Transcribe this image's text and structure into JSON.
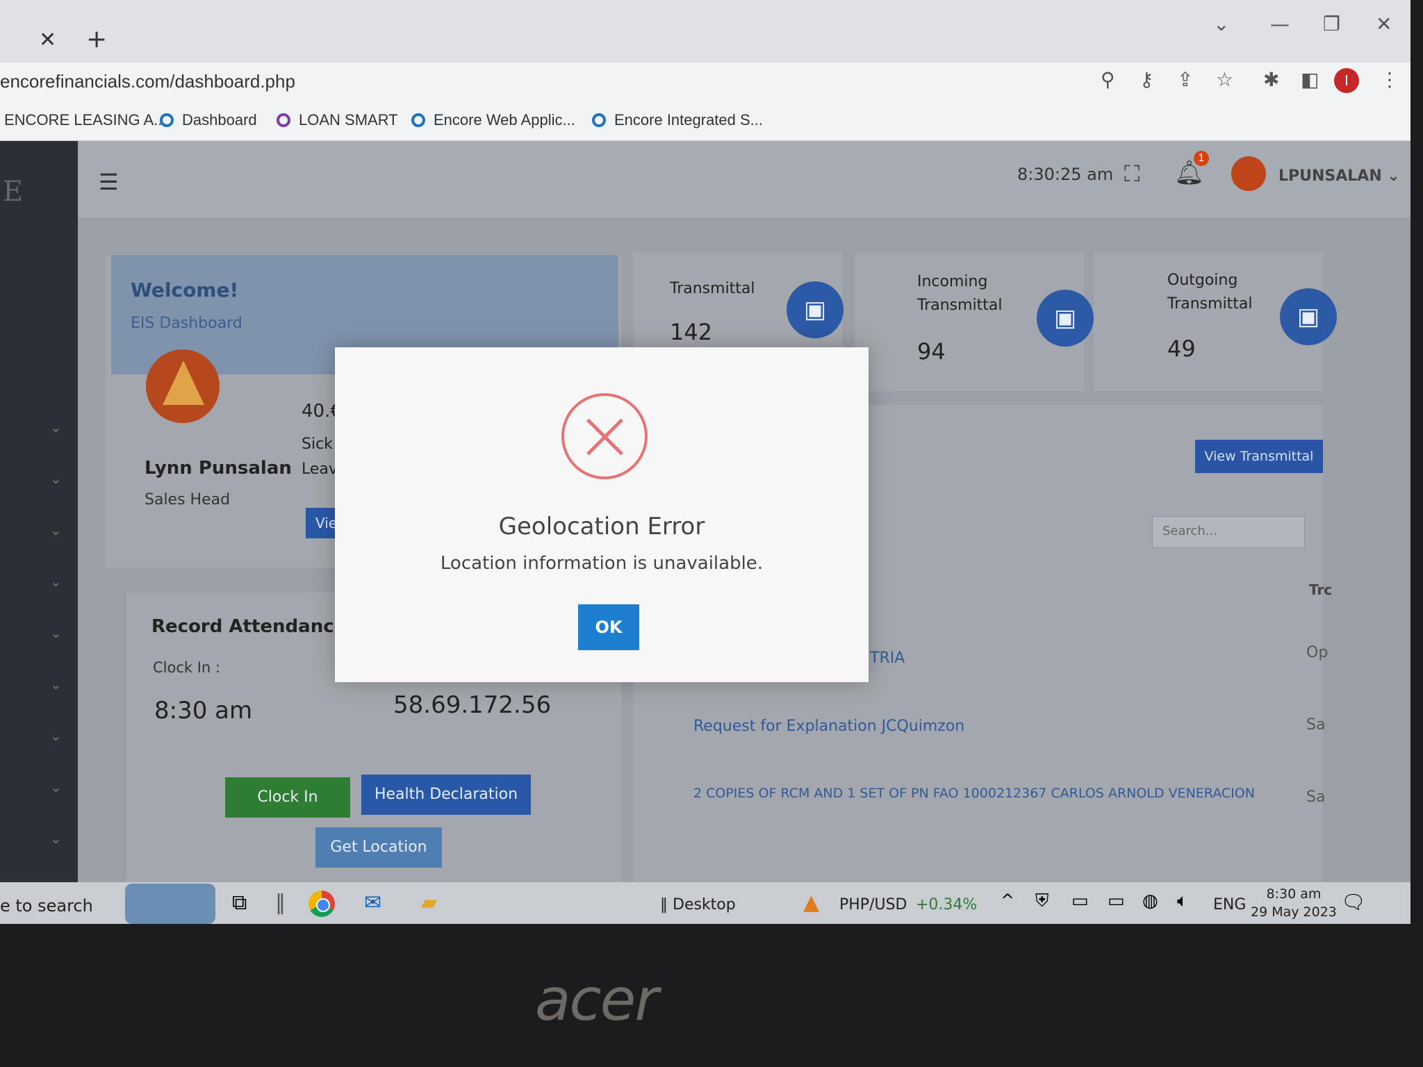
{
  "browser": {
    "url": "encorefinancials.com/dashboard.php",
    "bookmarks": [
      "ENCORE LEASING A...",
      "Dashboard",
      "LOAN SMART",
      "Encore Web Applic...",
      "Encore Integrated S..."
    ],
    "profile_initial": "I"
  },
  "topbar": {
    "clock": "8:30:25 am",
    "notification_count": "1",
    "username": "LPUNSALAN ⌄"
  },
  "welcome": {
    "title": "Welcome!",
    "subtitle": "EIS Dashboard",
    "name": "Lynn Punsalan",
    "role": "Sales Head",
    "leave_value": "40.€",
    "leave_label_1": "Sick",
    "leave_label_2": "Leav",
    "view_label": "Vie"
  },
  "stats": {
    "transmittal": {
      "label": "Transmittal",
      "value": "142"
    },
    "incoming": {
      "label_1": "Incoming",
      "label_2": "Transmittal",
      "value": "94"
    },
    "outgoing": {
      "label_1": "Outgoing",
      "label_2": "Transmittal",
      "value": "49"
    }
  },
  "transmittal_panel": {
    "view_button": "View Transmittal",
    "search_placeholder": "Search...",
    "column_header": "Trc",
    "rows": [
      {
        "text": "TRIA",
        "side": "Op"
      },
      {
        "text": "Request for Explanation JCQuimzon",
        "side": "Sa"
      },
      {
        "text": "2 COPIES OF RCM AND 1 SET OF PN FAO 1000212367 CARLOS ARNOLD VENERACION",
        "side": "Sa"
      }
    ]
  },
  "attendance": {
    "title": "Record Attendance",
    "clock_in_label": "Clock In :",
    "clock_in_time": "8:30 am",
    "ip_address": "58.69.172.56",
    "clock_in_button": "Clock In",
    "health_button": "Health Declaration",
    "location_button": "Get Location"
  },
  "modal": {
    "title": "Geolocation Error",
    "message": "Location information is unavailable.",
    "ok_button": "OK"
  },
  "taskbar": {
    "search_text": "e to search",
    "desktop_label": "Desktop",
    "currency": "PHP/USD",
    "currency_change": "+0.34%",
    "language": "ENG",
    "time": "8:30 am",
    "date": "29 May 2023"
  },
  "bezel": {
    "brand": "acer"
  },
  "colors": {
    "primary_blue": "#2d5aa6",
    "success_green": "#2e7d32",
    "error_red": "#e57373",
    "ok_blue": "#1e7fd0"
  }
}
